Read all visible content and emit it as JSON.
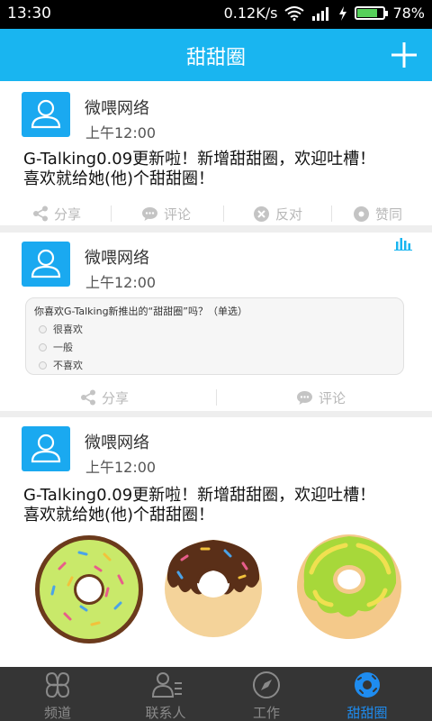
{
  "status": {
    "time": "13:30",
    "speed": "0.12K/s",
    "battery": "78%",
    "battery_level": 0.78
  },
  "header": {
    "title": "甜甜圈"
  },
  "posts": [
    {
      "author": "微喂网络",
      "time": "上午12:00",
      "text_line1": "G-Talking0.09更新啦！新增甜甜圈，欢迎吐槽！",
      "text_line2": "喜欢就给她(他)个甜甜圈！",
      "actions": {
        "share": "分享",
        "comment": "评论",
        "oppose": "反对",
        "agree": "赞同"
      }
    },
    {
      "author": "微喂网络",
      "time": "上午12:00",
      "poll": {
        "question": "你喜欢G-Talking新推出的“甜甜圈”吗？（单选）",
        "options": [
          "很喜欢",
          "一般",
          "不喜欢"
        ]
      },
      "actions": {
        "share": "分享",
        "comment": "评论"
      }
    },
    {
      "author": "微喂网络",
      "time": "上午12:00",
      "text_line1": "G-Talking0.09更新啦！新增甜甜圈，欢迎吐槽！",
      "text_line2": "喜欢就给她(他)个甜甜圈！"
    }
  ],
  "tabs": [
    "频道",
    "联系人",
    "工作",
    "甜甜圈"
  ],
  "colors": {
    "accent": "#19b5f0",
    "tab_active": "#1e8cf0"
  }
}
